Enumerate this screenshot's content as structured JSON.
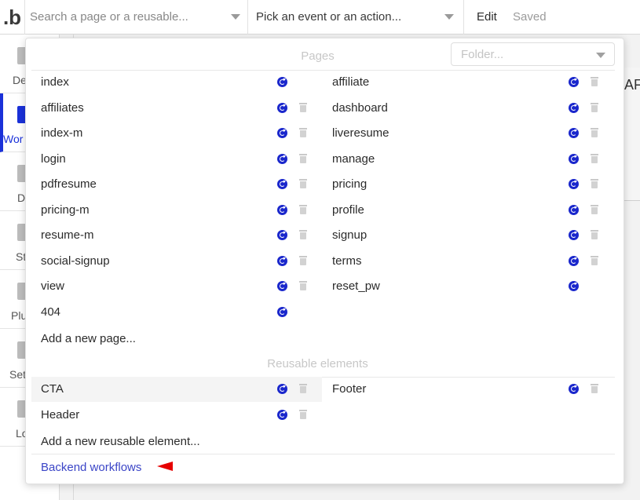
{
  "topbar": {
    "logo": ".b",
    "search_placeholder": "Search a page or a reusable...",
    "event_label": "Pick an event or an action...",
    "edit_label": "Edit",
    "saved_label": "Saved"
  },
  "sidebar": {
    "items": [
      {
        "label": "De",
        "active": false
      },
      {
        "label": "Wor",
        "active": true
      },
      {
        "label": "D",
        "active": false
      },
      {
        "label": "St",
        "active": false
      },
      {
        "label": "Plu",
        "active": false
      },
      {
        "label": "Set",
        "active": false
      },
      {
        "label": "Lo",
        "active": false
      }
    ]
  },
  "canvas": {
    "partial_text": "AF"
  },
  "panel": {
    "pages_title": "Pages",
    "folder_placeholder": "Folder...",
    "pages_left": [
      {
        "name": "index",
        "trash": false
      },
      {
        "name": "affiliates",
        "trash": true
      },
      {
        "name": "index-m",
        "trash": true
      },
      {
        "name": "login",
        "trash": true
      },
      {
        "name": "pdfresume",
        "trash": true
      },
      {
        "name": "pricing-m",
        "trash": true
      },
      {
        "name": "resume-m",
        "trash": true
      },
      {
        "name": "social-signup",
        "trash": true
      },
      {
        "name": "view",
        "trash": true
      },
      {
        "name": "404",
        "trash": false
      }
    ],
    "pages_right": [
      {
        "name": "affiliate",
        "trash": true
      },
      {
        "name": "dashboard",
        "trash": true
      },
      {
        "name": "liveresume",
        "trash": true
      },
      {
        "name": "manage",
        "trash": true
      },
      {
        "name": "pricing",
        "trash": true
      },
      {
        "name": "profile",
        "trash": true
      },
      {
        "name": "signup",
        "trash": true
      },
      {
        "name": "terms",
        "trash": true
      },
      {
        "name": "reset_pw",
        "trash": false
      }
    ],
    "add_page_label": "Add a new page...",
    "reusable_title": "Reusable elements",
    "reusables_left": [
      {
        "name": "CTA",
        "trash": true,
        "highlight": true
      },
      {
        "name": "Header",
        "trash": true,
        "highlight": false
      }
    ],
    "reusables_right": [
      {
        "name": "Footer",
        "trash": true,
        "highlight": false
      }
    ],
    "add_reusable_label": "Add a new reusable element...",
    "backend_label": "Backend workflows"
  },
  "colors": {
    "accent": "#1a31d9",
    "sync_icon": "#1a27cc",
    "link": "#3b45c7",
    "annotation_arrow": "#e60000"
  },
  "icons": [
    "sync-icon",
    "trash-icon",
    "chevron-down-icon",
    "arrow-left-icon"
  ]
}
